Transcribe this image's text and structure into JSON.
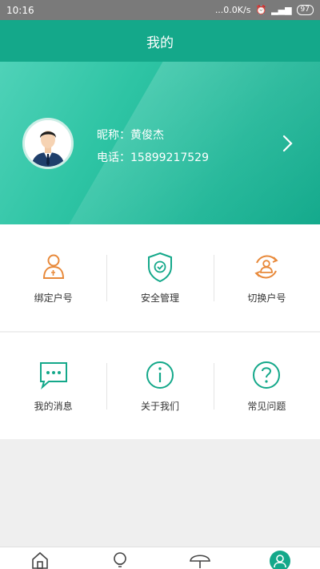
{
  "status_bar": {
    "time": "10:16",
    "speed": "...0.0K/s",
    "battery": "97"
  },
  "header": {
    "title": "我的"
  },
  "profile": {
    "nickname": "昵称：黄俊杰",
    "phone": "电话：15899217529"
  },
  "menu": {
    "row1": [
      {
        "label": "绑定户号",
        "icon": "user-bind-icon"
      },
      {
        "label": "安全管理",
        "icon": "shield-check-icon"
      },
      {
        "label": "切换户号",
        "icon": "user-switch-icon"
      }
    ],
    "row2": [
      {
        "label": "我的消息",
        "icon": "message-icon"
      },
      {
        "label": "关于我们",
        "icon": "info-icon"
      },
      {
        "label": "常见问题",
        "icon": "question-icon"
      }
    ]
  },
  "bottom_nav": [
    {
      "icon": "home-icon"
    },
    {
      "icon": "lightbulb-icon"
    },
    {
      "icon": "umbrella-icon"
    },
    {
      "icon": "profile-icon",
      "active": true
    }
  ],
  "colors": {
    "accent": "#14a88a",
    "orange": "#e8893a"
  }
}
